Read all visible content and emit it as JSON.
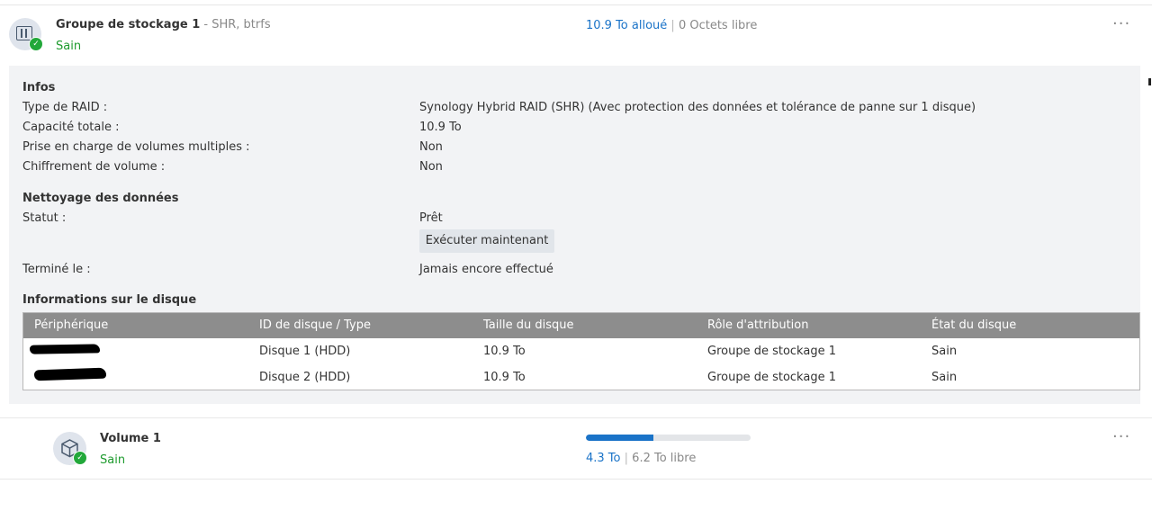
{
  "pool": {
    "title": "Groupe de stockage 1",
    "subtitle": " - SHR, btrfs",
    "status": "Sain",
    "allocated": "10.9 To alloué",
    "separator": "|",
    "free": "0 Octets libre",
    "menu_icon": "···"
  },
  "infos": {
    "heading": "Infos",
    "rows": [
      {
        "label": "Type de RAID :",
        "value": "Synology Hybrid RAID (SHR) (Avec protection des données et tolérance de panne sur 1 disque)"
      },
      {
        "label": "Capacité totale :",
        "value": "10.9 To"
      },
      {
        "label": "Prise en charge de volumes multiples :",
        "value": "Non"
      },
      {
        "label": "Chiffrement de volume :",
        "value": "Non"
      }
    ]
  },
  "scrub": {
    "heading": "Nettoyage des données",
    "status_label": "Statut :",
    "status_value": "Prêt",
    "run_button": "Exécuter maintenant",
    "done_label": "Terminé le :",
    "done_value": "Jamais encore effectué"
  },
  "disks": {
    "heading": "Informations sur le disque",
    "columns": [
      "Périphérique",
      "ID de disque / Type",
      "Taille du disque",
      "Rôle d'attribution",
      "État du disque"
    ],
    "rows": [
      {
        "id": "Disque 1 (HDD)",
        "size": "10.9 To",
        "role": "Groupe de stockage 1",
        "state": "Sain"
      },
      {
        "id": "Disque 2 (HDD)",
        "size": "10.9 To",
        "role": "Groupe de stockage 1",
        "state": "Sain"
      }
    ]
  },
  "volume": {
    "title": "Volume 1",
    "status": "Sain",
    "used": "4.3 To",
    "separator": "|",
    "free": "6.2 To libre",
    "used_fraction": 0.41,
    "menu_icon": "···"
  },
  "colors": {
    "accent": "#1a73c8",
    "healthy": "#1e9b2e",
    "table_header": "#8d8d8d"
  },
  "icons": [
    "storage-pool-icon",
    "check-icon",
    "more-icon",
    "volume-cube-icon"
  ]
}
